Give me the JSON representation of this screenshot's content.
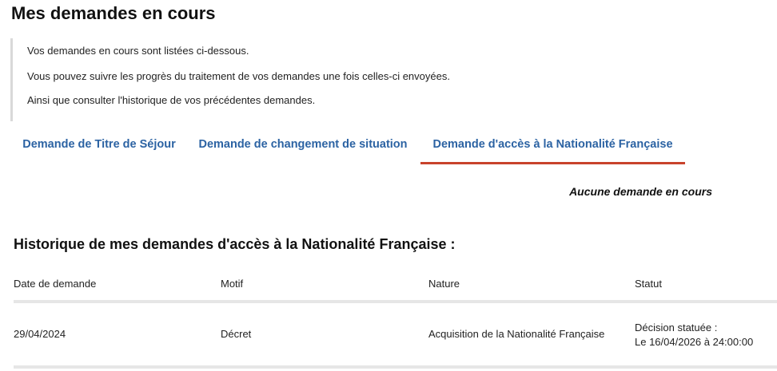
{
  "page": {
    "title": "Mes demandes en cours"
  },
  "intro": {
    "lines": [
      "Vos demandes en cours sont listées ci-dessous.",
      "Vous pouvez suivre les progrès du traitement de vos demandes une fois celles-ci envoyées.",
      "Ainsi que consulter l'historique de vos précédentes demandes."
    ]
  },
  "tabs": [
    {
      "label": "Demande de Titre de Séjour",
      "active": false
    },
    {
      "label": "Demande de changement de situation",
      "active": false
    },
    {
      "label": "Demande d'accès à la Nationalité Française",
      "active": true
    }
  ],
  "current": {
    "empty_message": "Aucune demande en cours"
  },
  "history": {
    "title": "Historique de mes demandes d'accès à la Nationalité Française :",
    "columns": [
      "Date de demande",
      "Motif",
      "Nature",
      "Statut"
    ],
    "rows": [
      {
        "date": "29/04/2024",
        "motif": "Décret",
        "nature": "Acquisition de la Nationalité Française",
        "statut_line1": "Décision statuée :",
        "statut_line2": "Le 16/04/2026 à 24:00:00"
      }
    ]
  },
  "colors": {
    "tab_text": "#2c63a3",
    "active_tab_underline": "#c8432c",
    "divider": "#e6e6e6",
    "intro_border": "#d9d9d9"
  }
}
